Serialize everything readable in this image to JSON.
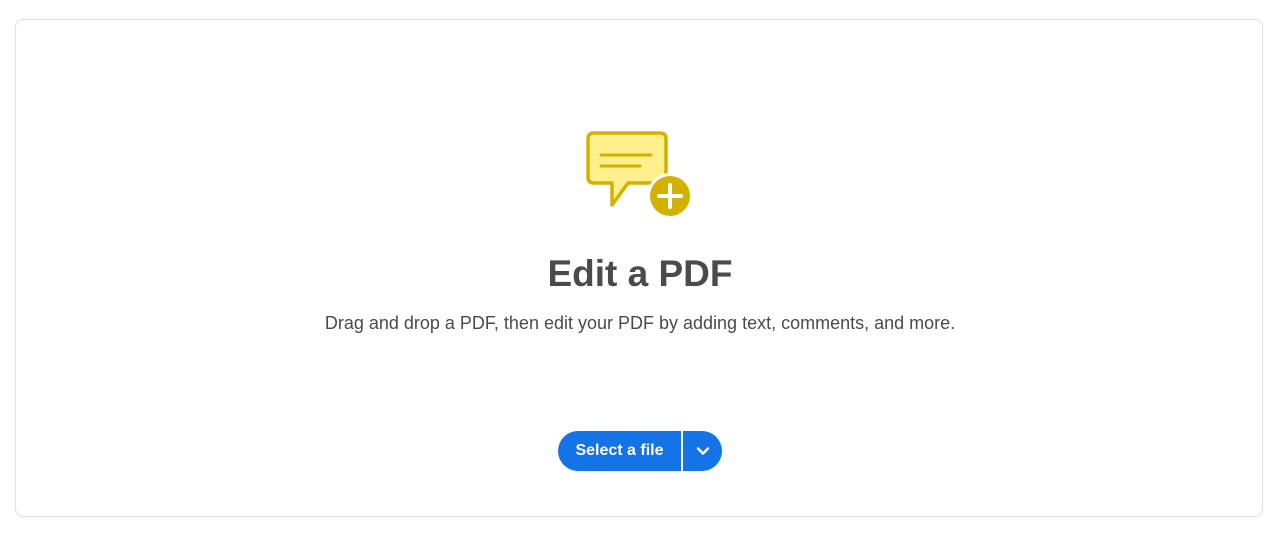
{
  "main": {
    "title": "Edit a PDF",
    "subtitle": "Drag and drop a PDF, then edit your PDF by adding text, comments, and more.",
    "select_button_label": "Select a file"
  },
  "icons": {
    "hero": "comment-add-icon",
    "dropdown": "chevron-down-icon"
  },
  "colors": {
    "accent": "#1473e6",
    "icon_fill": "#fdf08d",
    "icon_stroke": "#d3b100",
    "text": "#4b4b4b"
  }
}
